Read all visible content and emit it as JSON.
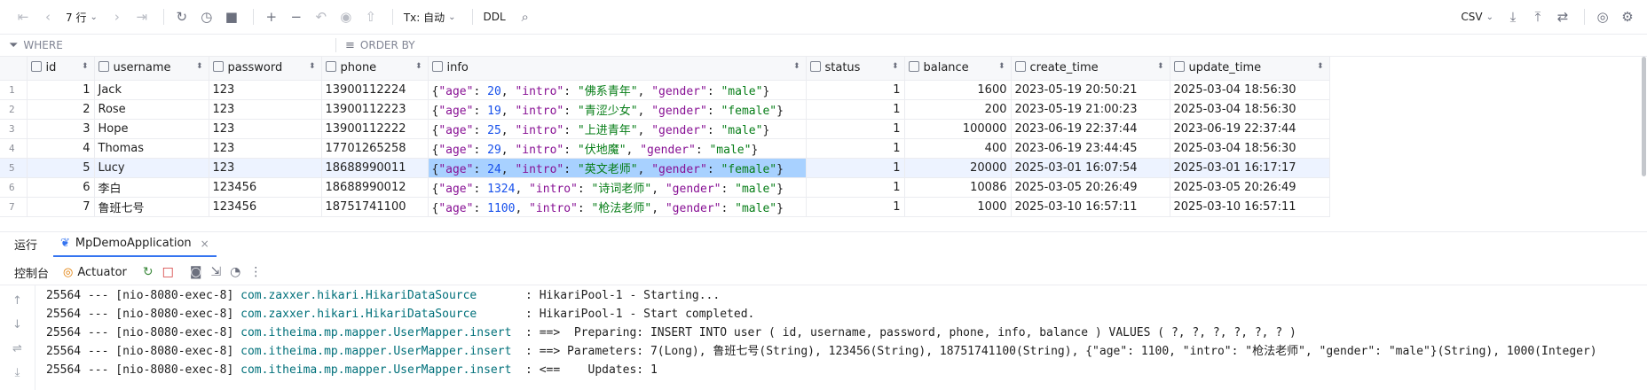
{
  "toolbar": {
    "rows_label": "7 行",
    "tx_label": "Tx: 自动",
    "ddl_label": "DDL",
    "export_format": "CSV"
  },
  "filter": {
    "where_placeholder": "WHERE",
    "orderby_placeholder": "ORDER BY"
  },
  "grid": {
    "columns": [
      "id",
      "username",
      "password",
      "phone",
      "info",
      "status",
      "balance",
      "create_time",
      "update_time"
    ],
    "rows": [
      {
        "rn": "1",
        "id": "1",
        "username": "Jack",
        "password": "123",
        "phone": "13900112224",
        "info": {
          "age": "20",
          "intro": "佛系青年",
          "gender": "male"
        },
        "status": "1",
        "balance": "1600",
        "create_time": "2023-05-19 20:50:21",
        "update_time": "2025-03-04 18:56:30"
      },
      {
        "rn": "2",
        "id": "2",
        "username": "Rose",
        "password": "123",
        "phone": "13900112223",
        "info": {
          "age": "19",
          "intro": "青涩少女",
          "gender": "female"
        },
        "status": "1",
        "balance": "200",
        "create_time": "2023-05-19 21:00:23",
        "update_time": "2025-03-04 18:56:30"
      },
      {
        "rn": "3",
        "id": "3",
        "username": "Hope",
        "password": "123",
        "phone": "13900112222",
        "info": {
          "age": "25",
          "intro": "上进青年",
          "gender": "male"
        },
        "status": "1",
        "balance": "100000",
        "create_time": "2023-06-19 22:37:44",
        "update_time": "2023-06-19 22:37:44"
      },
      {
        "rn": "4",
        "id": "4",
        "username": "Thomas",
        "password": "123",
        "phone": "17701265258",
        "info": {
          "age": "29",
          "intro": "伏地魔",
          "gender": "male"
        },
        "status": "1",
        "balance": "400",
        "create_time": "2023-06-19 23:44:45",
        "update_time": "2025-03-04 18:56:30"
      },
      {
        "rn": "5",
        "id": "5",
        "username": "Lucy",
        "password": "123",
        "phone": "18688990011",
        "info": {
          "age": "24",
          "intro": "英文老师",
          "gender": "female"
        },
        "status": "1",
        "balance": "20000",
        "create_time": "2025-03-01 16:07:54",
        "update_time": "2025-03-01 16:17:17"
      },
      {
        "rn": "6",
        "id": "6",
        "username": "李白",
        "password": "123456",
        "phone": "18688990012",
        "info": {
          "age": "1324",
          "intro": "诗词老师",
          "gender": "male"
        },
        "status": "1",
        "balance": "10086",
        "create_time": "2025-03-05 20:26:49",
        "update_time": "2025-03-05 20:26:49"
      },
      {
        "rn": "7",
        "id": "7",
        "username": "鲁班七号",
        "password": "123456",
        "phone": "18751741100",
        "info": {
          "age": "1100",
          "intro": "枪法老师",
          "gender": "male"
        },
        "status": "1",
        "balance": "1000",
        "create_time": "2025-03-10 16:57:11",
        "update_time": "2025-03-10 16:57:11"
      }
    ]
  },
  "toolwindow": {
    "title": "运行",
    "run_tab": "MpDemoApplication",
    "console_label": "控制台",
    "actuator_label": "Actuator"
  },
  "log": [
    {
      "pid": "25564 --- [nio-8080-exec-8] ",
      "cls": "com.zaxxer.hikari.HikariDataSource      ",
      "msg": " : HikariPool-1 - Starting..."
    },
    {
      "pid": "25564 --- [nio-8080-exec-8] ",
      "cls": "com.zaxxer.hikari.HikariDataSource      ",
      "msg": " : HikariPool-1 - Start completed."
    },
    {
      "pid": "25564 --- [nio-8080-exec-8] ",
      "cls": "com.itheima.mp.mapper.UserMapper.insert ",
      "msg": " : ==>  Preparing: INSERT INTO user ( id, username, password, phone, info, balance ) VALUES ( ?, ?, ?, ?, ?, ? )"
    },
    {
      "pid": "25564 --- [nio-8080-exec-8] ",
      "cls": "com.itheima.mp.mapper.UserMapper.insert ",
      "msg": " : ==> Parameters: 7(Long), 鲁班七号(String), 123456(String), 18751741100(String), {\"age\": 1100, \"intro\": \"枪法老师\", \"gender\": \"male\"}(String), 1000(Integer)"
    },
    {
      "pid": "25564 --- [nio-8080-exec-8] ",
      "cls": "com.itheima.mp.mapper.UserMapper.insert ",
      "msg": " : <==    Updates: 1"
    }
  ]
}
